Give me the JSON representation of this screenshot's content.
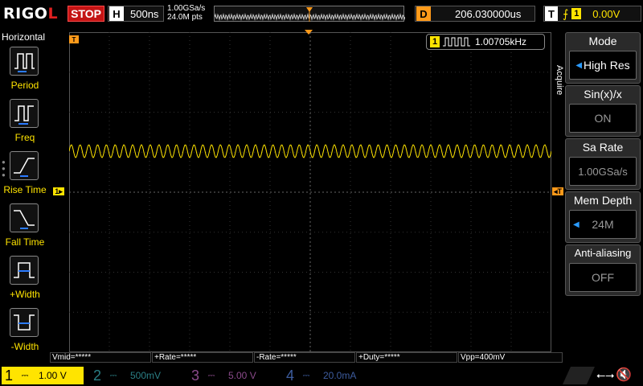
{
  "topbar": {
    "logo_main": "RIGO",
    "logo_end": "L",
    "run_state": "STOP",
    "horizontal": {
      "key": "H",
      "timebase": "500ns"
    },
    "sample_rate": "1.00GSa/s",
    "points": "24.0M pts",
    "delay": {
      "key": "D",
      "value": "206.030000us"
    },
    "trigger": {
      "key": "T",
      "source": "1",
      "level": "0.00V"
    }
  },
  "left_panel": {
    "title": "Horizontal",
    "items": [
      {
        "label": "Period"
      },
      {
        "label": "Freq"
      },
      {
        "label": "Rise Time"
      },
      {
        "label": "Fall Time"
      },
      {
        "label": "+Width"
      },
      {
        "label": "-Width"
      }
    ]
  },
  "frequency_badge": {
    "channel": "1",
    "value": "1.00705kHz"
  },
  "right_menu": {
    "side_label": "Acquire",
    "items": [
      {
        "title": "Mode",
        "value": "High Res"
      },
      {
        "title": "Sin(x)/x",
        "value": "ON"
      },
      {
        "title": "Sa Rate",
        "value": "1.00GSa/s"
      },
      {
        "title": "Mem Depth",
        "value": "24M"
      },
      {
        "title": "Anti-aliasing",
        "value": "OFF"
      }
    ]
  },
  "measurements": [
    {
      "text": "Vmid=*****"
    },
    {
      "text": "+Rate=*****"
    },
    {
      "text": "-Rate=*****"
    },
    {
      "text": "+Duty=*****"
    },
    {
      "text": "Vpp=400mV"
    }
  ],
  "channels": [
    {
      "num": "1",
      "scale": "1.00 V",
      "color": "#ffe400",
      "active": true
    },
    {
      "num": "2",
      "scale": "500mV",
      "color": "#00e5ff",
      "active": false
    },
    {
      "num": "3",
      "scale": "5.00 V",
      "color": "#ff40ff",
      "active": false
    },
    {
      "num": "4",
      "scale": "20.0mA",
      "color": "#2b7bff",
      "active": false
    }
  ],
  "colors": {
    "ch1": "#ffe400",
    "trigger": "#ff9a1a",
    "stop": "#c41414",
    "grid": "#3a3a3a"
  }
}
